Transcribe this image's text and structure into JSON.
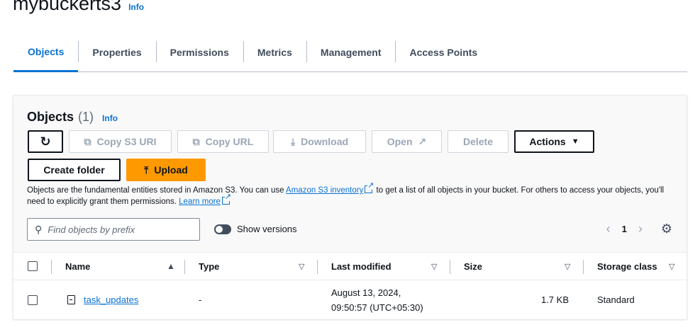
{
  "bucket": {
    "name": "mybuckerts3",
    "info_label": "Info"
  },
  "tabs": [
    {
      "label": "Objects"
    },
    {
      "label": "Properties"
    },
    {
      "label": "Permissions"
    },
    {
      "label": "Metrics"
    },
    {
      "label": "Management"
    },
    {
      "label": "Access Points"
    }
  ],
  "objects_panel": {
    "title": "Objects",
    "count": "(1)",
    "info_label": "Info",
    "buttons": {
      "copy_s3_uri": "Copy S3 URI",
      "copy_url": "Copy URL",
      "download": "Download",
      "open": "Open",
      "delete": "Delete",
      "actions": "Actions",
      "create_folder": "Create folder",
      "upload": "Upload"
    },
    "description": {
      "part1": "Objects are the fundamental entities stored in Amazon S3. You can use ",
      "link1": "Amazon S3 inventory",
      "part2": " to get a list of all objects in your bucket. For others to access your objects, you'll need to explicitly grant them permissions. ",
      "link2": "Learn more"
    },
    "search_placeholder": "Find objects by prefix",
    "show_versions_label": "Show versions",
    "current_page": "1"
  },
  "table": {
    "columns": {
      "name": "Name",
      "type": "Type",
      "last_modified": "Last modified",
      "size": "Size",
      "storage_class": "Storage class"
    },
    "rows": [
      {
        "name": "task_updates",
        "type": "-",
        "last_modified_line1": "August 13, 2024,",
        "last_modified_line2": "09:50:57 (UTC+05:30)",
        "size": "1.7 KB",
        "storage_class": "Standard"
      }
    ]
  },
  "colors": {
    "accent": "#0972d3",
    "primary_button": "#ff9900"
  }
}
